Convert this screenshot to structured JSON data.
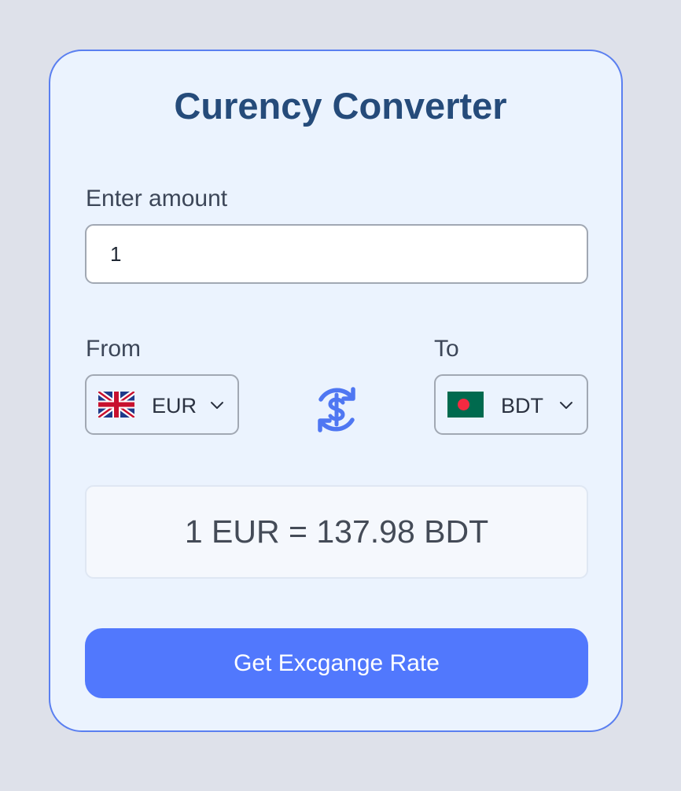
{
  "title": "Curency Converter",
  "amount": {
    "label": "Enter amount",
    "value": "1"
  },
  "from": {
    "label": "From",
    "currency": "EUR",
    "flag_icon": "uk-flag-icon"
  },
  "to": {
    "label": "To",
    "currency": "BDT",
    "flag_icon": "bangladesh-flag-icon"
  },
  "swap_icon": "currency-exchange-icon",
  "result": {
    "text": "1 EUR = 137.98 BDT"
  },
  "button": {
    "label": "Get Excgange Rate"
  },
  "colors": {
    "background": "#dee1ea",
    "card": "#ebf3fe",
    "card_border": "#5a7ff0",
    "title": "#254b7a",
    "accent": "#5178fd",
    "swap_icon": "#4f77f2"
  }
}
